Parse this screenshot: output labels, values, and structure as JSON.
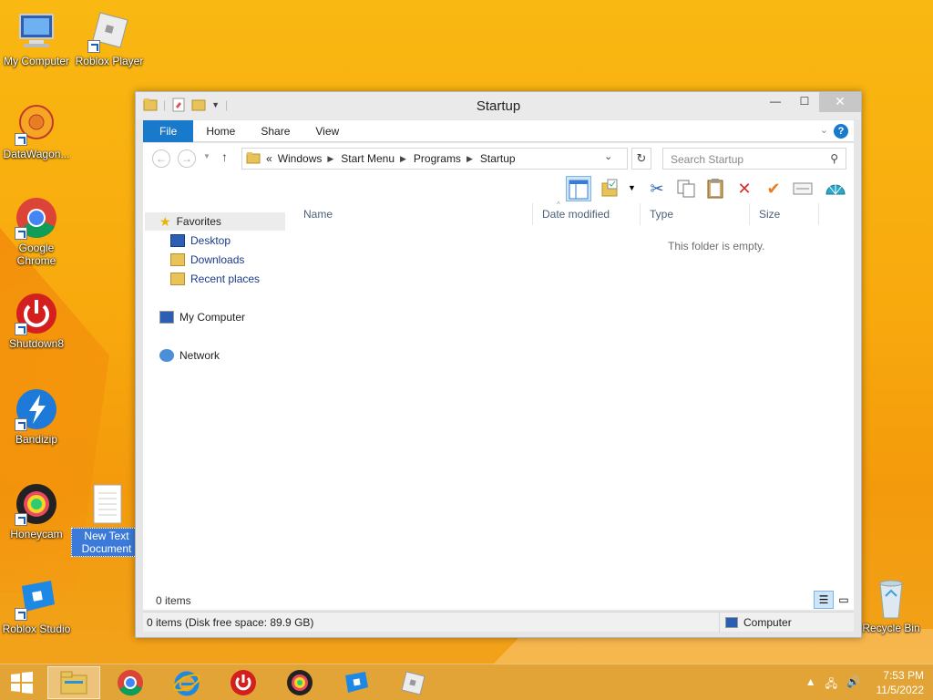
{
  "desktop": {
    "icons": [
      {
        "label": "My Computer"
      },
      {
        "label": "Roblox Player"
      },
      {
        "label": "DataWagon..."
      },
      {
        "label": "Google Chrome"
      },
      {
        "label": "Shutdown8"
      },
      {
        "label": "Bandizip"
      },
      {
        "label": "Honeycam"
      },
      {
        "label": "New Text Document"
      },
      {
        "label": "Roblox Studio"
      },
      {
        "label": "Recycle Bin"
      }
    ]
  },
  "window": {
    "title": "Startup",
    "ribbon_tabs": [
      "File",
      "Home",
      "Share",
      "View"
    ],
    "help": "?",
    "address": {
      "overflow": "«",
      "crumbs": [
        "Windows",
        "Start Menu",
        "Programs",
        "Startup"
      ]
    },
    "search_placeholder": "Search Startup",
    "nav": {
      "favorites": "Favorites",
      "desktop": "Desktop",
      "downloads": "Downloads",
      "recent": "Recent places",
      "my_computer": "My Computer",
      "network": "Network"
    },
    "columns": [
      "Name",
      "Date modified",
      "Type",
      "Size"
    ],
    "empty_message": "This folder is empty.",
    "items_count": "0 items",
    "details": "0 items (Disk free space: 89.9 GB)",
    "details_location": "Computer"
  },
  "taskbar": {
    "time": "7:53 PM",
    "date": "11/5/2022"
  },
  "colors": {
    "accent": "#1979ca",
    "desktop": "#f8a90d"
  }
}
